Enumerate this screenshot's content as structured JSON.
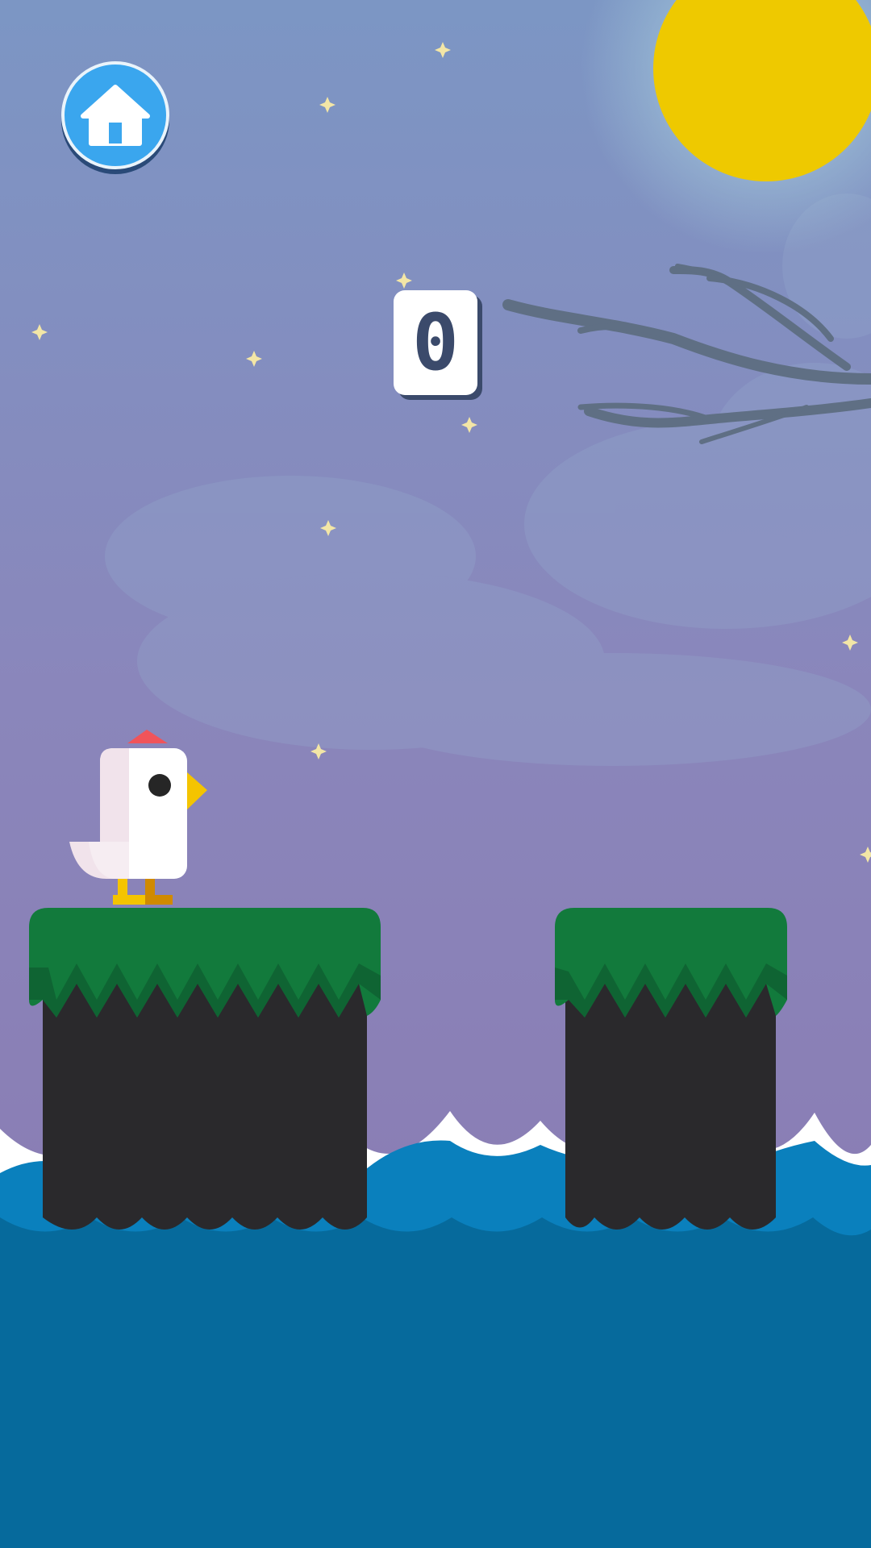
{
  "game": {
    "score": "0"
  },
  "hud": {
    "home_icon": "home-icon"
  },
  "scene": {
    "sky_top_color": "#7c96c4",
    "sky_bottom_color": "#8a78b0",
    "moon_color": "#eec900",
    "grass_color": "#127a3c",
    "pillar_color": "#2a292c",
    "sea_color": "#0077b5",
    "deep_sea_color": "#066a9c"
  }
}
